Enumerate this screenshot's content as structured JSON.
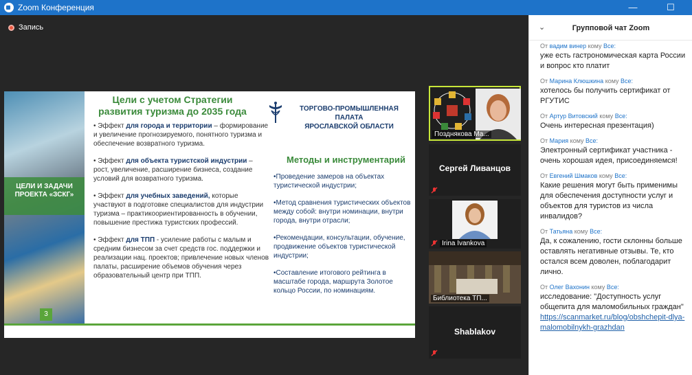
{
  "window": {
    "title": "Zoom Конференция",
    "minimize": "—",
    "maximize": "☐",
    "close": "✕"
  },
  "recording": {
    "label": "Запись"
  },
  "slide": {
    "banner": "ЦЕЛИ И ЗАДАЧИ ПРОЕКТА «ЗСКГ»",
    "page_number": "3",
    "title": "Цели с учетом Стратегии развития туризма до 2035 года",
    "org_line1": "ТОРГОВО-ПРОМЫШЛЕННАЯ ПАЛАТА",
    "org_line2": "ЯРОСЛАВСКОЙ ОБЛАСТИ",
    "goals": [
      {
        "prefix": "Эффект ",
        "bold": "для города и территории",
        "rest": " – формирование и увеличение прогнозируемого, понятного туризма и обеспечение возвратного туризма."
      },
      {
        "prefix": "Эффект ",
        "bold": "для объекта туристской индустрии",
        "rest": " – рост, увеличение, расширение бизнеса, создание условий для возвратного туризма."
      },
      {
        "prefix": "Эффект ",
        "bold": "для учебных заведений,",
        "rest": " которые участвуют в подготовке специалистов для индустрии туризма – практикоориентированность в обучении, повышение престижа туристских профессий."
      },
      {
        "prefix": "Эффект ",
        "bold": "для ТПП",
        "rest": " - усиление работы с малым и средним бизнесом за счет средств гос. поддержки и реализации нац. проектов; привлечение новых членов палаты, расширение объемов обучения через образовательный центр при ТПП."
      }
    ],
    "methods_title": "Методы и инструментарий",
    "methods": [
      "•Проведение замеров на объектах туристической индустрии;",
      "•Метод сравнения туристических объектов между собой: внутри номинации, внутри города, внутри отрасли;",
      "•Рекомендации, консультации, обучение, продвижение объектов туристической индустрии;",
      "•Составление итогового рейтинга в масштабе города, маршрута Золотое кольцо России, по номинациям."
    ]
  },
  "participants": [
    {
      "name": "Позднякова Ма..."
    },
    {
      "name": "Сергей Ливанцов"
    },
    {
      "name": "Irina Ivankova"
    },
    {
      "name": "Библиотека ТП..."
    },
    {
      "name": "Shablakov"
    }
  ],
  "chat": {
    "title": "Групповой чат Zoom",
    "from": "От",
    "to": "кому",
    "everyone": "Все:",
    "messages": [
      {
        "sender": "вадим винер",
        "text": "уже есть гастрономическая карта России  и вопрос кто платит"
      },
      {
        "sender": "Марина Клюшкина",
        "text": "хотелось бы получить сертификат от РГУТИС"
      },
      {
        "sender": "Артур Витовский",
        "text": "Очень интересная презентация)"
      },
      {
        "sender": "Мария",
        "text": "Электронный сертификат участника - очень хорошая идея, присоединяемся!"
      },
      {
        "sender": "Евгений Шмаков",
        "text": "Какие решения могут быть применимы для обеспечения доступности услуг и объектов для туристов из числа инвалидов?"
      },
      {
        "sender": "Татьяна",
        "text": "Да, к сожалению, гости склонны больше оставлять негативные отзывы. Те, кто остался всем доволен, поблагодарит лично."
      },
      {
        "sender": "Олег Вахонин",
        "text": "исследование: \"Доступность услуг общепита для маломобильных граждан\"",
        "link": "https://scanmarket.ru/blog/obshchepit-dlya-malomobilnykh-grazhdan"
      }
    ]
  }
}
